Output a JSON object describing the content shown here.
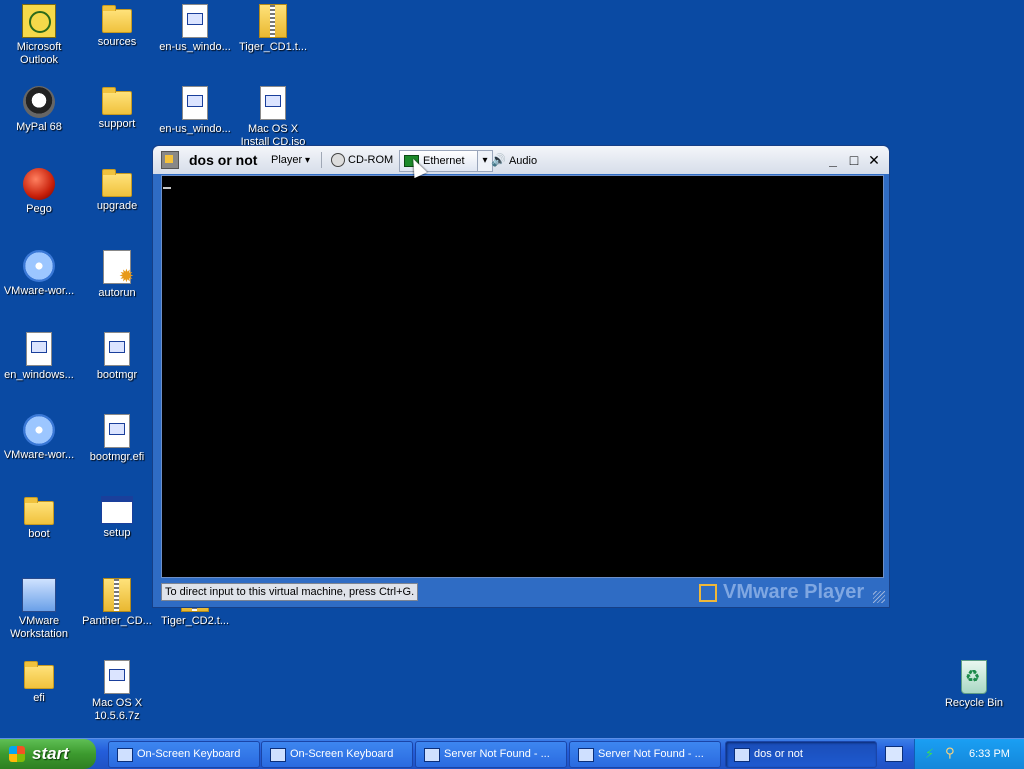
{
  "desktop_icons": [
    {
      "label": "Microsoft\nOutlook",
      "icon": "outlook-icon"
    },
    {
      "label": "sources",
      "icon": "folder-icon"
    },
    {
      "label": "en-us_windo...",
      "icon": "file-icon"
    },
    {
      "label": "Tiger_CD1.t...",
      "icon": "zip-file-icon"
    },
    {
      "label": "MyPal 68",
      "icon": "raccoon-icon"
    },
    {
      "label": "support",
      "icon": "folder-icon"
    },
    {
      "label": "en-us_windo...",
      "icon": "file-icon"
    },
    {
      "label": "Mac OS X\nInstall CD.iso",
      "icon": "file-icon"
    },
    {
      "label": "Pego",
      "icon": "pego-icon"
    },
    {
      "label": "upgrade",
      "icon": "folder-icon"
    },
    {
      "label": "VMware-wor...",
      "icon": "cd-installer-icon"
    },
    {
      "label": "autorun",
      "icon": "settings-file-icon"
    },
    {
      "label": "en_windows...",
      "icon": "file-icon"
    },
    {
      "label": "bootmgr",
      "icon": "file-icon"
    },
    {
      "label": "VMware-wor...",
      "icon": "cd-installer-icon"
    },
    {
      "label": "bootmgr.efi",
      "icon": "file-icon"
    },
    {
      "label": "boot",
      "icon": "folder-icon"
    },
    {
      "label": "setup",
      "icon": "window-app-icon"
    },
    {
      "label": "VMware\nWorkstation",
      "icon": "vmware-workstation-icon"
    },
    {
      "label": "Panther_CD...",
      "icon": "zip-file-icon"
    },
    {
      "label": "Tiger_CD2.t...",
      "icon": "zip-file-icon"
    },
    {
      "label": "efi",
      "icon": "folder-icon"
    },
    {
      "label": "Mac OS X\n10.5.6.7z",
      "icon": "file-icon"
    },
    {
      "label": "Recycle Bin",
      "icon": "recycle-bin-icon"
    }
  ],
  "vm_window": {
    "title": "dos or not",
    "menu_player": "Player",
    "device_cdrom": "CD-ROM",
    "device_ethernet": "Ethernet",
    "device_audio": "Audio",
    "status_hint": "To direct input to this virtual machine, press Ctrl+G.",
    "brand": "VMware Player"
  },
  "taskbar": {
    "start_label": "start",
    "tasks": [
      {
        "label": "On-Screen Keyboard"
      },
      {
        "label": "On-Screen Keyboard"
      },
      {
        "label": "Server Not Found - ..."
      },
      {
        "label": "Server Not Found - ..."
      },
      {
        "label": "dos or not"
      }
    ],
    "clock": "6:33 PM"
  }
}
